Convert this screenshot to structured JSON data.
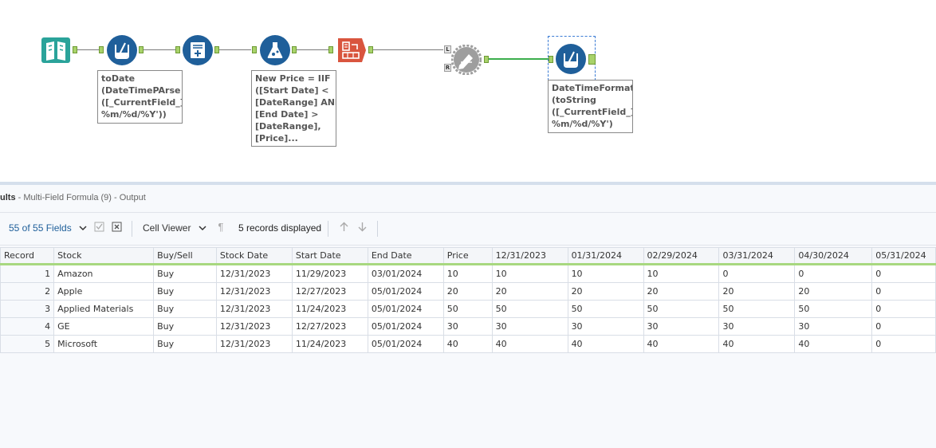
{
  "workflow": {
    "annotations": {
      "todate": "toDate\n(DateTimePArse\n([_CurrentField_],'\n%m/%d/%Y'))",
      "new_price": "New Price = IIF\n([Start Date] <\n[DateRange] AND\n[End Date] >\n[DateRange],\n[Price]...",
      "datetimeformat": "DateTimeFormat\n(toString\n([_CurrentField_]),'\n%m/%d/%Y')"
    },
    "join_anchor_left": "L",
    "join_anchor_right": "R"
  },
  "results": {
    "title_prefix": "ults",
    "title_suffix": " - Multi-Field Formula (9) - Output",
    "fields_label": "55 of 55 Fields",
    "cell_viewer_label": "Cell Viewer",
    "records_label": "5 records displayed"
  },
  "table": {
    "columns": [
      "Record",
      "Stock",
      "Buy/Sell",
      "Stock Date",
      "Start Date",
      "End Date",
      "Price",
      "12/31/2023",
      "01/31/2024",
      "02/29/2024",
      "03/31/2024",
      "04/30/2024",
      "05/31/2024"
    ],
    "rows": [
      [
        "1",
        "Amazon",
        "Buy",
        "12/31/2023",
        "11/29/2023",
        "03/01/2024",
        "10",
        "10",
        "10",
        "10",
        "0",
        "0",
        "0"
      ],
      [
        "2",
        "Apple",
        "Buy",
        "12/31/2023",
        "12/27/2023",
        "05/01/2024",
        "20",
        "20",
        "20",
        "20",
        "20",
        "20",
        "0"
      ],
      [
        "3",
        "Applied Materials",
        "Buy",
        "12/31/2023",
        "11/24/2023",
        "05/01/2024",
        "50",
        "50",
        "50",
        "50",
        "50",
        "50",
        "0"
      ],
      [
        "4",
        "GE",
        "Buy",
        "12/31/2023",
        "12/27/2023",
        "05/01/2024",
        "30",
        "30",
        "30",
        "30",
        "30",
        "30",
        "0"
      ],
      [
        "5",
        "Microsoft",
        "Buy",
        "12/31/2023",
        "11/24/2023",
        "05/01/2024",
        "40",
        "40",
        "40",
        "40",
        "40",
        "40",
        "0"
      ]
    ]
  },
  "colors": {
    "accent": "#1f5f9a",
    "anchor": "#a8d26a",
    "selected_connection": "#3cae4c",
    "header_underline": "#a8d880"
  }
}
